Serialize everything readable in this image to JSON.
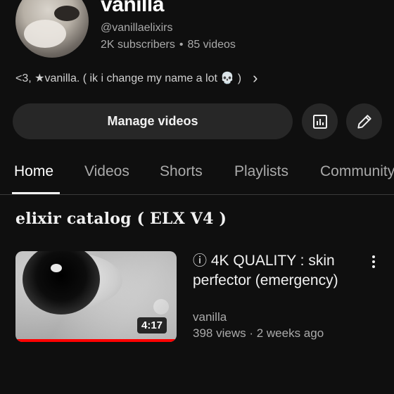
{
  "channel": {
    "name": "vanilla",
    "handle": "@vanillaelixirs",
    "subscribers": "2K subscribers",
    "videos": "85 videos",
    "separator": "•",
    "bio": "<3, ★vanilla. ( ik i change my name a lot 💀 )",
    "bio_more": "›"
  },
  "actions": {
    "manage_videos": "Manage videos",
    "stats_icon": "analytics-icon",
    "edit_icon": "pencil-icon"
  },
  "tabs": [
    {
      "label": "Home",
      "active": true
    },
    {
      "label": "Videos"
    },
    {
      "label": "Shorts"
    },
    {
      "label": "Playlists"
    },
    {
      "label": "Community"
    }
  ],
  "section": {
    "title": "elixir catalog ( ELX V4 )"
  },
  "video": {
    "info_icon": "ⓘ",
    "title": "4K QUALITY : skin perfector (emergency)",
    "channel": "vanilla",
    "meta": "398 views · 2 weeks ago",
    "duration": "4:17",
    "watched_fraction": 1.0
  },
  "colors": {
    "background": "#0f0f0f",
    "button": "#272727",
    "secondary_text": "#aaaaaa",
    "progress": "#ff0000"
  }
}
